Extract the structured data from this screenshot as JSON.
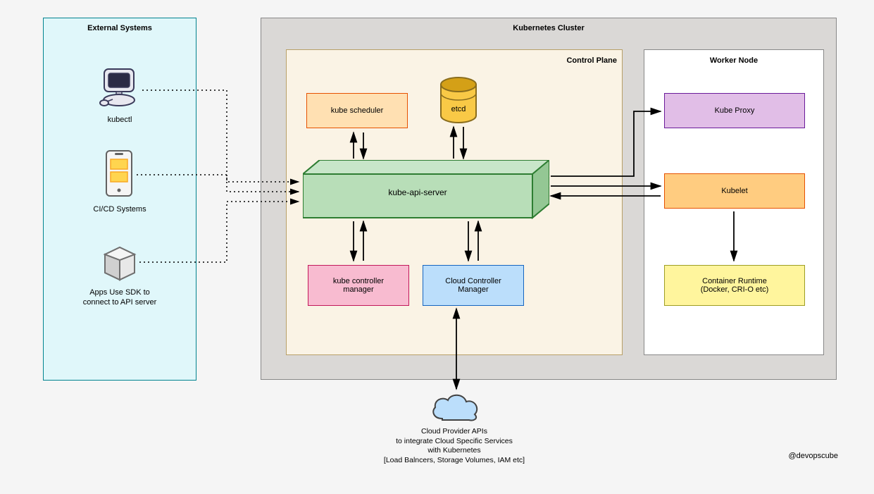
{
  "external": {
    "title": "External Systems",
    "kubectl": "kubectl",
    "cicd": "CI/CD Systems",
    "apps": "Apps Use SDK to\nconnect to API server"
  },
  "cluster": {
    "title": "Kubernetes Cluster"
  },
  "controlPlane": {
    "title": "Control Plane",
    "scheduler": "kube scheduler",
    "etcd": "etcd",
    "apiServer": "kube-api-server",
    "controllerManager": "kube controller\nmanager",
    "cloudController": "Cloud Controller\nManager"
  },
  "worker": {
    "title": "Worker Node",
    "kubeProxy": "Kube Proxy",
    "kubelet": "Kubelet",
    "runtime": "Container Runtime\n(Docker, CRI-O etc)"
  },
  "cloud": {
    "text": "Cloud Provider APIs\nto integrate Cloud Specific Services\nwith Kubernetes\n[Load Balncers, Storage Volumes, IAM etc]"
  },
  "credit": "@devopscube"
}
